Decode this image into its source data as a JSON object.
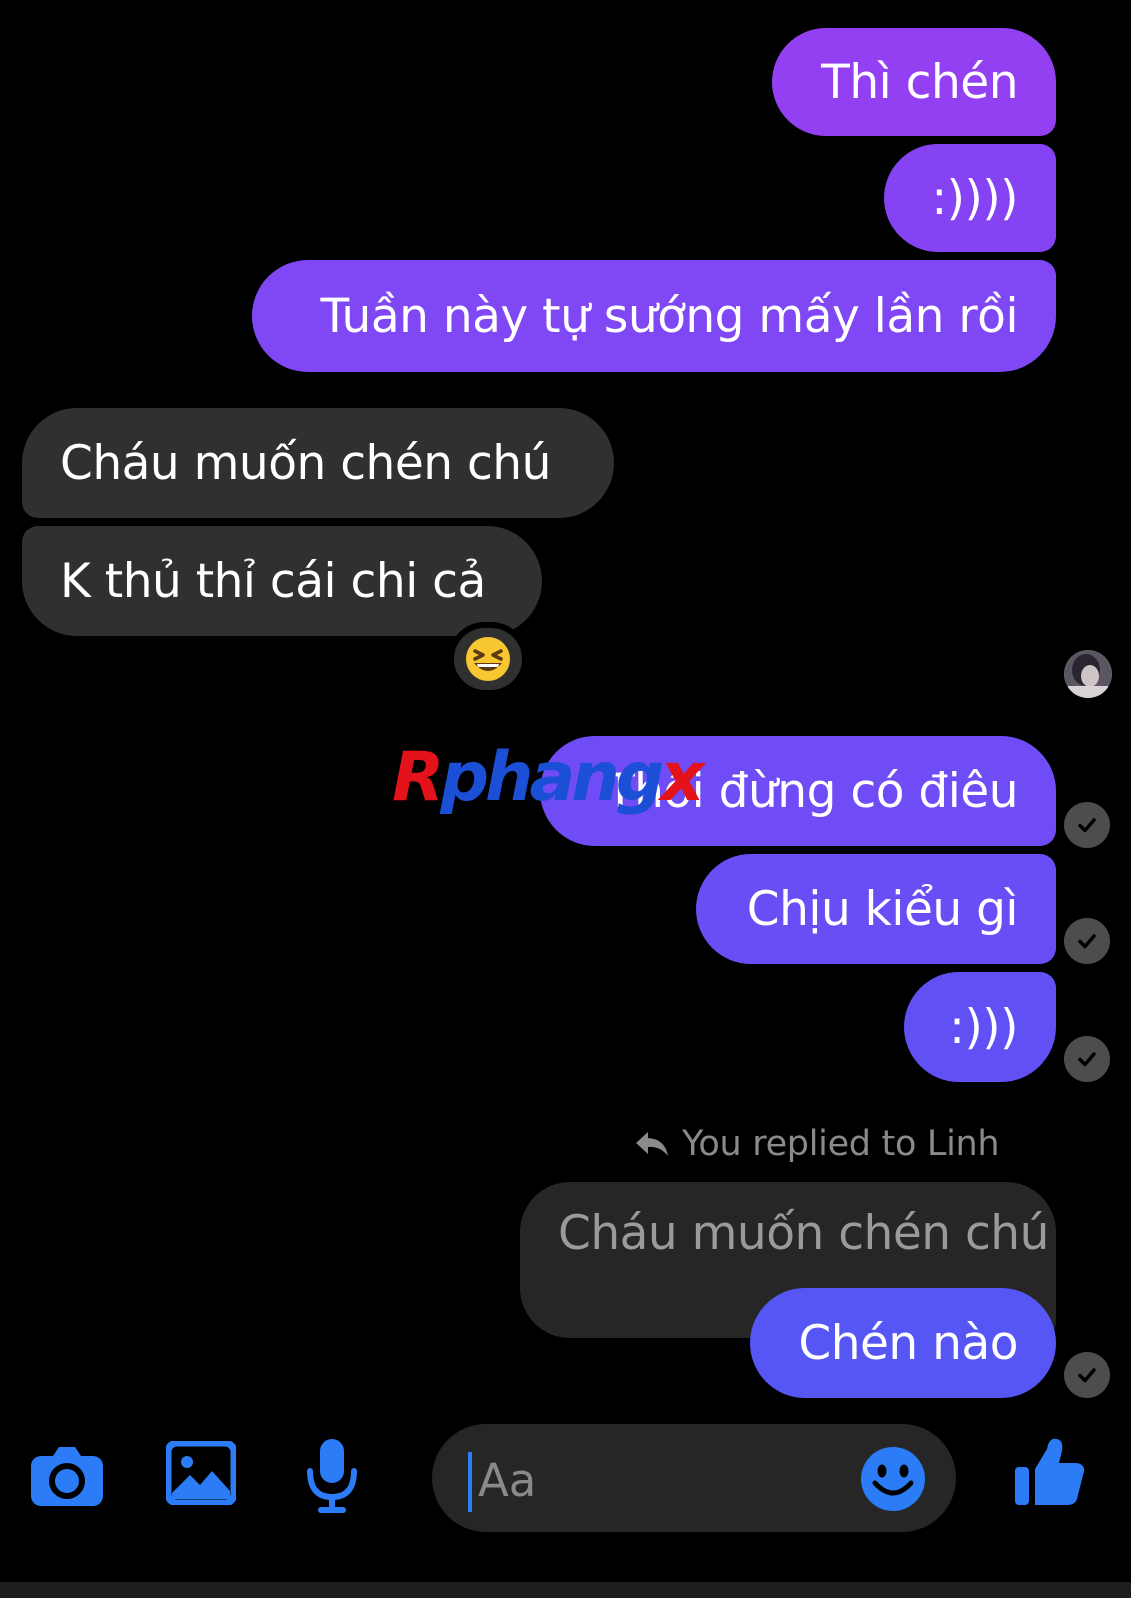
{
  "messages": {
    "m1": "Thì chén",
    "m2": ":))))",
    "m3": "Tuần này tự sướng mấy lần rồi",
    "m4": "Cháu muốn chén chú",
    "m5": "K thủ thỉ cái chi cả",
    "m6": "Thôi đừng có điêu",
    "m7": "Chịu kiểu gì",
    "m8": ":)))",
    "m9": "Chén nào"
  },
  "reply": {
    "label": "You replied to Linh",
    "quoted_text": "Cháu muốn chén chú"
  },
  "reaction_icon": "laughing-emoji-icon",
  "watermark": {
    "part1": "R",
    "part2": "phang",
    "part3": "x"
  },
  "composer": {
    "placeholder": "Aa",
    "icons": [
      "camera-icon",
      "image-icon",
      "microphone-icon",
      "emoji-icon",
      "thumbs-up-icon"
    ]
  },
  "colors": {
    "background": "#000000",
    "incoming_bubble": "#303030",
    "outgoing_top": "#9340f3",
    "outgoing_bottom": "#5656f4",
    "accent": "#2b7cf6"
  }
}
